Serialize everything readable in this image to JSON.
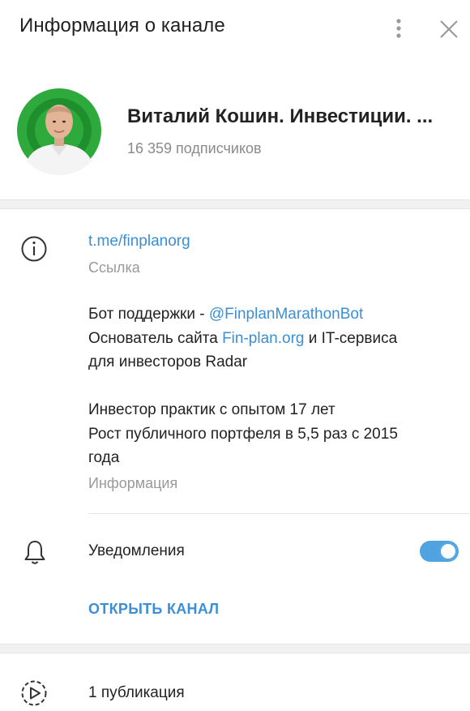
{
  "header": {
    "title": "Информация о канале",
    "menu_icon": "more-vertical-icon",
    "close_icon": "close-icon"
  },
  "profile": {
    "channel_name": "Виталий Кошин. Инвестиции. ...",
    "subscribers": "16 359 подписчиков",
    "avatar_ring_color": "#2eaa3c"
  },
  "link_section": {
    "link": "t.me/finplanorg",
    "link_caption": "Ссылка",
    "icon": "info-icon"
  },
  "description": {
    "line1_prefix": "Бот поддержки - ",
    "line1_link": "@FinplanMarathonBot",
    "line2_prefix": "Основатель сайта ",
    "line2_link": "Fin-plan.org",
    "line2_suffix": " и IT-сервиса",
    "line3": "для инвесторов Radar",
    "line4": "Инвестор практик с опытом 17 лет",
    "line5": "Рост публичного портфеля в 5,5 раз с 2015",
    "line6": "года",
    "caption": "Информация"
  },
  "notifications": {
    "label": "Уведомления",
    "enabled": true,
    "icon": "bell-icon"
  },
  "open_channel": {
    "label": "ОТКРЫТЬ КАНАЛ"
  },
  "publications": {
    "label": "1 публикация",
    "icon": "play-circle-icon"
  },
  "colors": {
    "accent": "#3a8fd6",
    "toggle": "#4fa3e0",
    "secondary_text": "#999999"
  }
}
